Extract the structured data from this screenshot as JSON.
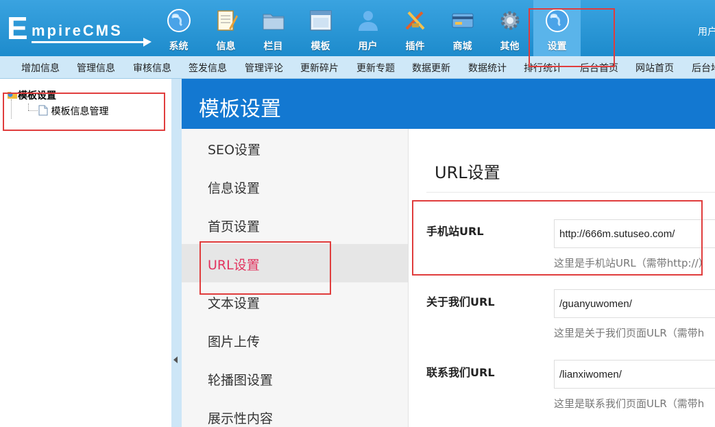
{
  "logo": {
    "big_letter": "E",
    "rest": "mpireCMS"
  },
  "nav": {
    "items": [
      {
        "label": "系统",
        "icon": "globe-icon"
      },
      {
        "label": "信息",
        "icon": "notepad-icon"
      },
      {
        "label": "栏目",
        "icon": "folder-icon"
      },
      {
        "label": "模板",
        "icon": "window-icon"
      },
      {
        "label": "用户",
        "icon": "user-icon"
      },
      {
        "label": "插件",
        "icon": "tools-icon"
      },
      {
        "label": "商城",
        "icon": "card-icon"
      },
      {
        "label": "其他",
        "icon": "gear-icon"
      },
      {
        "label": "设置",
        "icon": "globe-icon"
      }
    ],
    "active": "设置",
    "user_label": "用户"
  },
  "submenu": [
    "增加信息",
    "管理信息",
    "审核信息",
    "签发信息",
    "管理评论",
    "更新碎片",
    "更新专题",
    "数据更新",
    "数据统计",
    "排行统计",
    "后台首页",
    "网站首页",
    "后台地"
  ],
  "tree": {
    "root": "模板设置",
    "child": "模板信息管理"
  },
  "page_title": "模板设置",
  "setting_tabs": [
    "SEO设置",
    "信息设置",
    "首页设置",
    "URL设置",
    "文本设置",
    "图片上传",
    "轮播图设置",
    "展示性内容"
  ],
  "active_tab": "URL设置",
  "section_title": "URL设置",
  "fields": [
    {
      "label": "手机站URL",
      "value": "http://666m.sutuseo.com/",
      "help": "这里是手机站URL（需带http://）"
    },
    {
      "label": "关于我们URL",
      "value": "/guanyuwomen/",
      "help": "这里是关于我们页面ULR（需带h"
    },
    {
      "label": "联系我们URL",
      "value": "/lianxiwomen/",
      "help": "这里是联系我们页面ULR（需带h"
    }
  ],
  "colors": {
    "header": "#2594d4",
    "title_bar": "#1378d1",
    "active_tab_text": "#e2345f",
    "highlight": "#e03c3c"
  }
}
